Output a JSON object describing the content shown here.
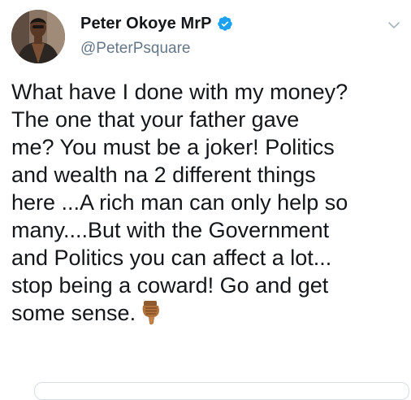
{
  "user": {
    "display_name": "Peter Okoye MrP",
    "handle": "@PeterPsquare",
    "avatar_icon": "profile-avatar",
    "verified_icon": "verified-badge-icon"
  },
  "tweet": {
    "lines": [
      "What have I done with my money?",
      "The one that your father gave",
      "me? You must be a joker! Politics",
      "and wealth na 2 different things",
      "here ...A rich man can only help so",
      "many....But with the Government",
      "and Politics you can affect a lot...",
      "stop being a coward! Go and get",
      "some sense."
    ],
    "trailing_emoji": "thumbs-down-icon"
  },
  "menu": {
    "icon": "chevron-down-icon"
  },
  "colors": {
    "text": "#14171a",
    "secondary": "#657786",
    "verified": "#1da1f2",
    "border": "#d6dde3"
  }
}
